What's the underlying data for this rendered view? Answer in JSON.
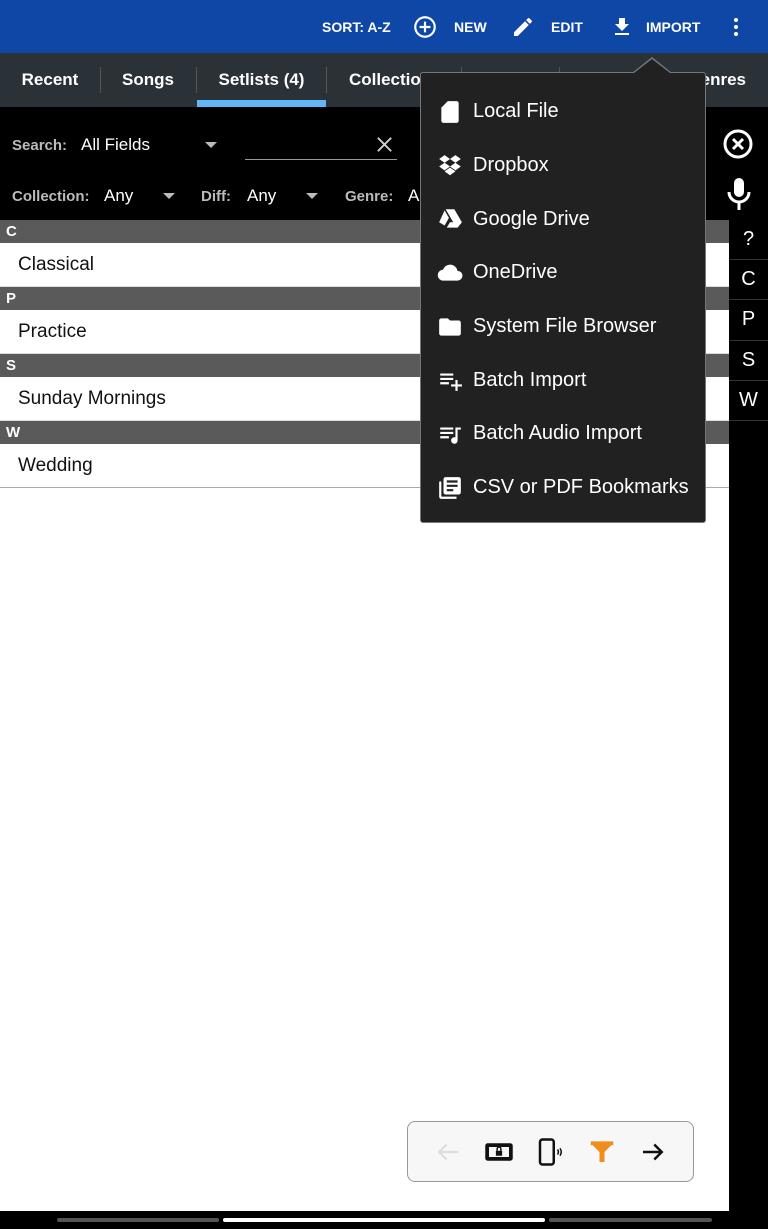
{
  "toolbar": {
    "sort": "SORT: A-Z",
    "new": "NEW",
    "edit": "EDIT",
    "import": "IMPORT"
  },
  "tabs": [
    "Recent",
    "Songs",
    "Setlists (4)",
    "Collections",
    "",
    "",
    "Genres"
  ],
  "filters": {
    "search_label": "Search:",
    "search_field": "All Fields",
    "search_value": "",
    "collection_label": "Collection:",
    "collection_value": "Any",
    "diff_label": "Diff:",
    "diff_value": "Any",
    "genre_label": "Genre:",
    "genre_value": "Any"
  },
  "list": [
    {
      "header": "C",
      "items": [
        "Classical"
      ]
    },
    {
      "header": "P",
      "items": [
        "Practice"
      ]
    },
    {
      "header": "S",
      "items": [
        "Sunday Mornings"
      ]
    },
    {
      "header": "W",
      "items": [
        "Wedding"
      ]
    }
  ],
  "index": [
    "?",
    "C",
    "P",
    "S",
    "W"
  ],
  "import_menu": [
    "Local File",
    "Dropbox",
    "Google Drive",
    "OneDrive",
    "System File Browser",
    "Batch Import",
    "Batch Audio Import",
    "CSV or PDF Bookmarks"
  ],
  "colors": {
    "toolbar": "#0f47a6",
    "tab_indicator": "#64b5f6",
    "filter_icon": "#f28c1c"
  }
}
